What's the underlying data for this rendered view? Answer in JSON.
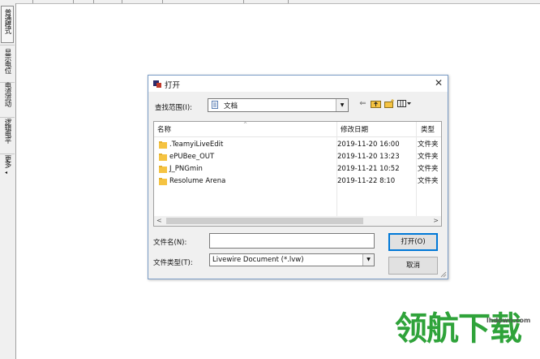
{
  "left_toolbar": {
    "tabs": [
      {
        "label": "普通模式"
      },
      {
        "label": "显示电位"
      },
      {
        "label": "电流流动"
      },
      {
        "label": "逻辑电平"
      },
      {
        "label": "更多"
      }
    ],
    "more_arrow": "◂"
  },
  "dialog": {
    "title": "打开",
    "close_glyph": "✕",
    "look_in_label": "查找范围(I):",
    "look_in_value": "文档",
    "columns": {
      "name": "名称",
      "modified": "修改日期",
      "type": "类型"
    },
    "files": [
      {
        "name": ".TeamyiLiveEdit",
        "modified": "2019-11-20 16:00",
        "type": "文件夹"
      },
      {
        "name": "ePUBee_OUT",
        "modified": "2019-11-20 13:23",
        "type": "文件夹"
      },
      {
        "name": "J_PNGmin",
        "modified": "2019-11-21 10:52",
        "type": "文件夹"
      },
      {
        "name": "Resolume Arena",
        "modified": "2019-11-22 8:10",
        "type": "文件夹"
      }
    ],
    "file_name_label": "文件名(N):",
    "file_name_value": "",
    "file_type_label": "文件类型(T):",
    "file_type_value": "Livewire Document (*.lvw)",
    "open_button": "打开(O)",
    "cancel_button": "取消",
    "scroll_left": "<",
    "scroll_right": ">"
  },
  "watermark": {
    "text": "领航下载",
    "url": "lhdown.com"
  },
  "colors": {
    "accent": "#0078d7",
    "watermark": "#2fa33a",
    "folder": "#f5c342"
  }
}
